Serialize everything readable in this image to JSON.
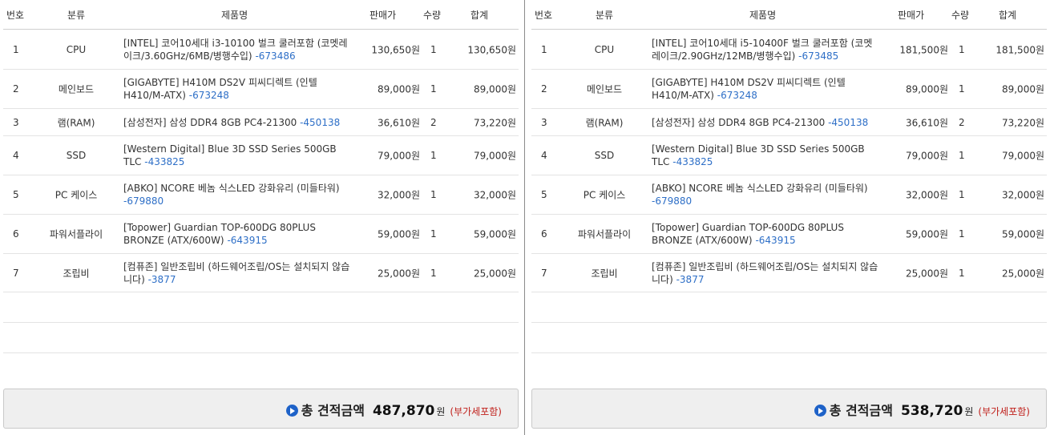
{
  "header": {
    "num": "번호",
    "category": "분류",
    "name": "제품명",
    "price": "판매가",
    "qty": "수량",
    "sum": "합계"
  },
  "left": {
    "rows": [
      {
        "num": "1",
        "category": "CPU",
        "name": "[INTEL] 코어10세대 i3-10100 벌크 쿨러포함 (코멧레이크/3.60GHz/6MB/병행수입)",
        "code": "-673486",
        "price": "130,650원",
        "qty": "1",
        "sum": "130,650원"
      },
      {
        "num": "2",
        "category": "메인보드",
        "name": "[GIGABYTE] H410M DS2V 피씨디렉트 (인텔H410/M-ATX)",
        "code": "-673248",
        "price": "89,000원",
        "qty": "1",
        "sum": "89,000원"
      },
      {
        "num": "3",
        "category": "램(RAM)",
        "name": "[삼성전자] 삼성 DDR4 8GB PC4-21300",
        "code": "-450138",
        "price": "36,610원",
        "qty": "2",
        "sum": "73,220원"
      },
      {
        "num": "4",
        "category": "SSD",
        "name": "[Western Digital] Blue 3D SSD Series 500GB TLC",
        "code": "-433825",
        "price": "79,000원",
        "qty": "1",
        "sum": "79,000원"
      },
      {
        "num": "5",
        "category": "PC 케이스",
        "name": "[ABKO] NCORE 베놈 식스LED 강화유리 (미들타워)",
        "code": "-679880",
        "price": "32,000원",
        "qty": "1",
        "sum": "32,000원"
      },
      {
        "num": "6",
        "category": "파워서플라이",
        "name": "[Topower] Guardian TOP-600DG 80PLUS BRONZE (ATX/600W)",
        "code": "-643915",
        "price": "59,000원",
        "qty": "1",
        "sum": "59,000원"
      },
      {
        "num": "7",
        "category": "조립비",
        "name": "[컴퓨존] 일반조립비 (하드웨어조립/OS는 설치되지 않습니다)",
        "code": "-3877",
        "price": "25,000원",
        "qty": "1",
        "sum": "25,000원"
      }
    ],
    "total": {
      "label": "총 견적금액",
      "amount": "487,870",
      "unit": "원",
      "vat": "(부가세포함)"
    }
  },
  "right": {
    "rows": [
      {
        "num": "1",
        "category": "CPU",
        "name": "[INTEL] 코어10세대 i5-10400F 벌크 쿨러포함 (코멧레이크/2.90GHz/12MB/병행수입)",
        "code": "-673485",
        "price": "181,500원",
        "qty": "1",
        "sum": "181,500원"
      },
      {
        "num": "2",
        "category": "메인보드",
        "name": "[GIGABYTE] H410M DS2V 피씨디렉트 (인텔H410/M-ATX)",
        "code": "-673248",
        "price": "89,000원",
        "qty": "1",
        "sum": "89,000원"
      },
      {
        "num": "3",
        "category": "램(RAM)",
        "name": "[삼성전자] 삼성 DDR4 8GB PC4-21300",
        "code": "-450138",
        "price": "36,610원",
        "qty": "2",
        "sum": "73,220원"
      },
      {
        "num": "4",
        "category": "SSD",
        "name": "[Western Digital] Blue 3D SSD Series 500GB TLC",
        "code": "-433825",
        "price": "79,000원",
        "qty": "1",
        "sum": "79,000원"
      },
      {
        "num": "5",
        "category": "PC 케이스",
        "name": "[ABKO] NCORE 베놈 식스LED 강화유리 (미들타워)",
        "code": "-679880",
        "price": "32,000원",
        "qty": "1",
        "sum": "32,000원"
      },
      {
        "num": "6",
        "category": "파워서플라이",
        "name": "[Topower] Guardian TOP-600DG 80PLUS BRONZE (ATX/600W)",
        "code": "-643915",
        "price": "59,000원",
        "qty": "1",
        "sum": "59,000원"
      },
      {
        "num": "7",
        "category": "조립비",
        "name": "[컴퓨존] 일반조립비 (하드웨어조립/OS는 설치되지 않습니다)",
        "code": "-3877",
        "price": "25,000원",
        "qty": "1",
        "sum": "25,000원"
      }
    ],
    "total": {
      "label": "총 견적금액",
      "amount": "538,720",
      "unit": "원",
      "vat": "(부가세포함)"
    }
  },
  "colors": {
    "code_link": "#2e6fc7",
    "vat": "#c0201b",
    "icon": "#1e62c8"
  },
  "icons": {
    "total_marker": "play-circle-icon"
  }
}
